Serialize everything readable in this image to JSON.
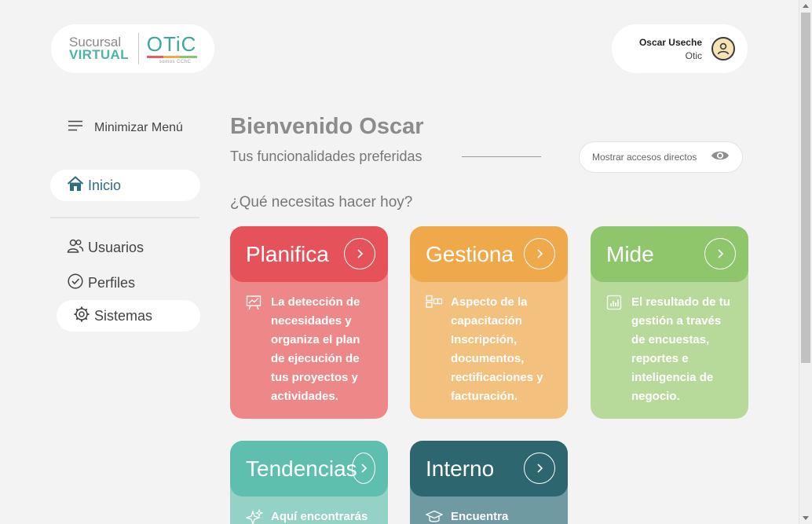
{
  "logo": {
    "line1": "Sucursal",
    "line2": "VIRTUAL",
    "brand": "OTiC",
    "tagline": "somos CChC"
  },
  "user": {
    "name": "Oscar Useche",
    "org": "Otic",
    "icon": "user-circle-icon"
  },
  "sidebar": {
    "toggle_label": "Minimizar Menú",
    "items": [
      {
        "label": "Inicio",
        "icon": "home-icon"
      },
      {
        "label": "Usuarios",
        "icon": "users-icon"
      },
      {
        "label": "Perfiles",
        "icon": "check-circle-icon"
      },
      {
        "label": "Sistemas",
        "icon": "gear-icon"
      }
    ]
  },
  "main": {
    "welcome": "Bienvenido Oscar",
    "subtitle": "Tus funcionalidades preferidas",
    "shortcuts_label": "Mostrar accesos directos",
    "question": "¿Qué necesitas hacer hoy?",
    "cards": [
      {
        "title": "Planifica",
        "text": "La detección de necesidades y organiza el plan de ejecución de tus proyectos y actividades.",
        "icon": "chart-board-icon",
        "color": "#e6525a"
      },
      {
        "title": "Gestiona",
        "text": "Aspecto de la capacitación Inscripción, documentos, rectificaciones y facturación.",
        "icon": "blocks-icon",
        "color": "#efa94a"
      },
      {
        "title": "Mide",
        "text": "El resultado de tu gestión a través de encuestas, reportes e inteligencia de negocio.",
        "icon": "bar-chart-icon",
        "color": "#8fc56b"
      },
      {
        "title": "Tendencias",
        "text": "Aquí encontrarás",
        "icon": "sparkle-icon",
        "color": "#5fbfae"
      },
      {
        "title": "Interno",
        "text": "Encuentra",
        "icon": "graduation-cap-icon",
        "color": "#2e6670"
      }
    ]
  }
}
